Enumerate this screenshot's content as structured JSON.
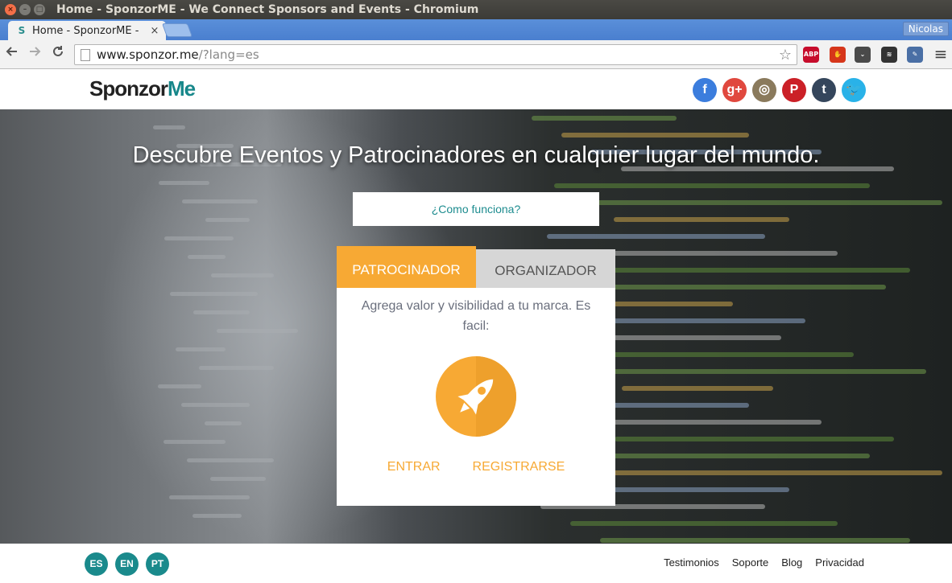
{
  "window": {
    "title": "Home - SponzorME - We Connect Sponsors and Events - Chromium",
    "close_glyph": "×",
    "min_glyph": "–",
    "max_glyph": "□"
  },
  "tabs": [
    {
      "favicon": "S",
      "label": "Home - SponzorME -",
      "close": "×"
    }
  ],
  "profile": {
    "name": "Nicolas"
  },
  "toolbar": {
    "back_icon": "back-arrow-icon",
    "forward_icon": "forward-arrow-icon",
    "reload_icon": "reload-icon",
    "url_host": "www.sponzor.me",
    "url_path": "/?lang=es",
    "star_glyph": "☆",
    "extensions": [
      {
        "name": "adblock-plus-icon",
        "label": "ABP",
        "color": "#c70d2c"
      },
      {
        "name": "stop-hand-icon",
        "label": "✋",
        "color": "#d6361a"
      },
      {
        "name": "pocket-icon",
        "label": "⌄",
        "color": "#4a4a4a"
      },
      {
        "name": "layers-icon",
        "label": "≋",
        "color": "#333333"
      },
      {
        "name": "eyedropper-icon",
        "label": "✎",
        "color": "#4a6fa5"
      }
    ],
    "menu_glyph": "≡"
  },
  "site": {
    "logo_part1": "Sponzor",
    "logo_part2": "Me",
    "social": [
      {
        "name": "facebook-icon",
        "glyph": "f",
        "color": "#3b7ddd"
      },
      {
        "name": "google-plus-icon",
        "glyph": "g+",
        "color": "#e0483e"
      },
      {
        "name": "instagram-icon",
        "glyph": "◎",
        "color": "#8a7a5c"
      },
      {
        "name": "pinterest-icon",
        "glyph": "P",
        "color": "#cb2027"
      },
      {
        "name": "tumblr-icon",
        "glyph": "t",
        "color": "#35465c"
      },
      {
        "name": "twitter-icon",
        "glyph": "🐦",
        "color": "#29b2e8"
      }
    ]
  },
  "hero": {
    "headline": "Descubre Eventos y Patrocinadores en cualquier lugar del mundo.",
    "how_it_works": "¿Como funciona?",
    "tab_sponsor": "PATROCINADOR",
    "tab_organizer": "ORGANIZADOR",
    "description": "Agrega valor y visibilidad a tu marca. Es facil:",
    "rocket_icon": "rocket-icon",
    "login": "ENTRAR",
    "register": "REGISTRARSE",
    "accent_color": "#f7a934"
  },
  "footer": {
    "languages": [
      "ES",
      "EN",
      "PT"
    ],
    "links": [
      "Testimonios",
      "Soporte",
      "Blog",
      "Privacidad"
    ]
  }
}
